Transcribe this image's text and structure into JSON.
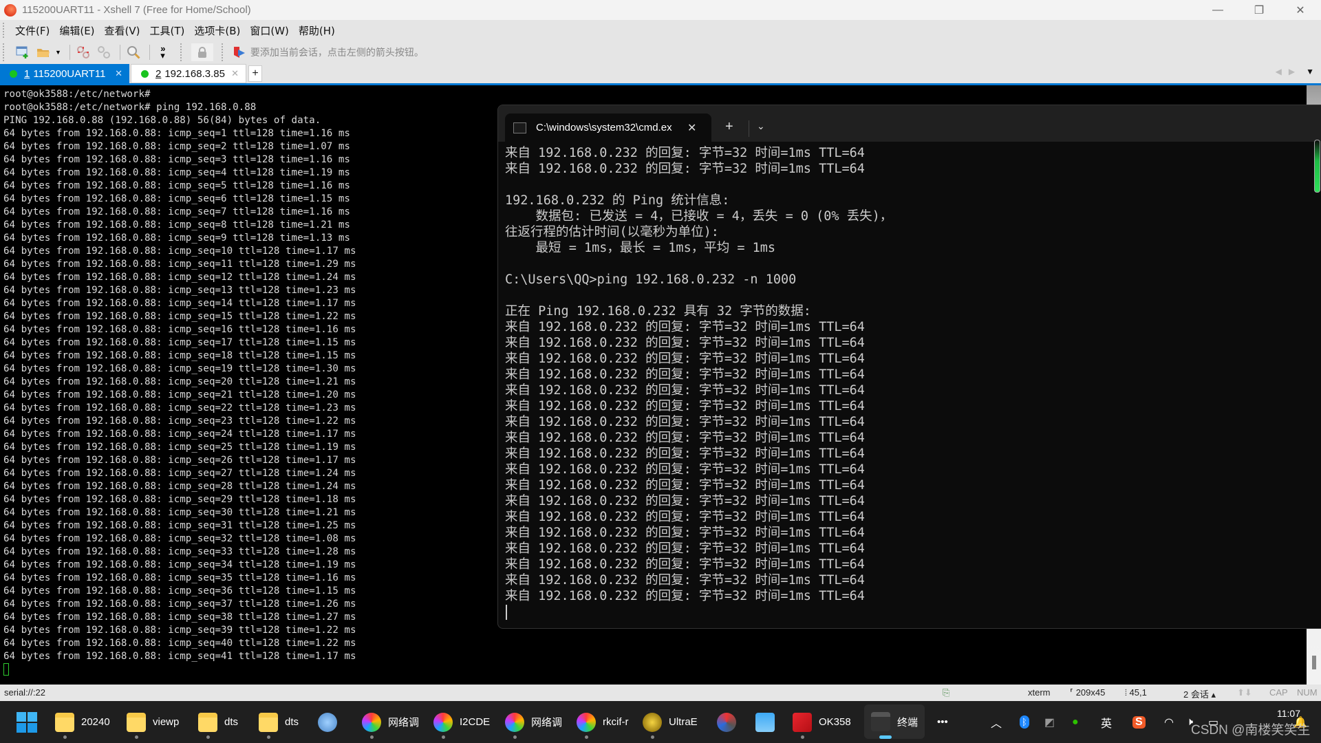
{
  "window": {
    "title": "115200UART11 - Xshell 7 (Free for Home/School)",
    "controls": {
      "minimize": "—",
      "restore": "❐",
      "close": "✕"
    }
  },
  "menu": [
    "文件(F)",
    "编辑(E)",
    "查看(V)",
    "工具(T)",
    "选项卡(B)",
    "窗口(W)",
    "帮助(H)"
  ],
  "toolbar": {
    "hint": "要添加当前会话，点击左侧的箭头按钮。",
    "buttons": [
      "new-session-icon",
      "open-folder-icon",
      "disconnect-icon",
      "reconnect-icon",
      "find-icon",
      "more-icon",
      "lock-icon"
    ]
  },
  "tabs": [
    {
      "index": "1",
      "label": "115200UART11",
      "status": "connected",
      "active": true
    },
    {
      "index": "2",
      "label": "192.168.3.85",
      "status": "connected",
      "active": false
    }
  ],
  "tab_add": "+",
  "xshell": {
    "prompt_lines": [
      "root@ok3588:/etc/network#",
      "root@ok3588:/etc/network# ping 192.168.0.88",
      "PING 192.168.0.88 (192.168.0.88) 56(84) bytes of data."
    ],
    "ping_host": "192.168.0.88",
    "ping_bytes": "64",
    "ttl": "128",
    "replies": [
      {
        "seq": 1,
        "time": "1.16"
      },
      {
        "seq": 2,
        "time": "1.07"
      },
      {
        "seq": 3,
        "time": "1.16"
      },
      {
        "seq": 4,
        "time": "1.19"
      },
      {
        "seq": 5,
        "time": "1.16"
      },
      {
        "seq": 6,
        "time": "1.15"
      },
      {
        "seq": 7,
        "time": "1.16"
      },
      {
        "seq": 8,
        "time": "1.21"
      },
      {
        "seq": 9,
        "time": "1.13"
      },
      {
        "seq": 10,
        "time": "1.17"
      },
      {
        "seq": 11,
        "time": "1.29"
      },
      {
        "seq": 12,
        "time": "1.24"
      },
      {
        "seq": 13,
        "time": "1.23"
      },
      {
        "seq": 14,
        "time": "1.17"
      },
      {
        "seq": 15,
        "time": "1.22"
      },
      {
        "seq": 16,
        "time": "1.16"
      },
      {
        "seq": 17,
        "time": "1.15"
      },
      {
        "seq": 18,
        "time": "1.15"
      },
      {
        "seq": 19,
        "time": "1.30"
      },
      {
        "seq": 20,
        "time": "1.21"
      },
      {
        "seq": 21,
        "time": "1.20"
      },
      {
        "seq": 22,
        "time": "1.23"
      },
      {
        "seq": 23,
        "time": "1.22"
      },
      {
        "seq": 24,
        "time": "1.17"
      },
      {
        "seq": 25,
        "time": "1.19"
      },
      {
        "seq": 26,
        "time": "1.17"
      },
      {
        "seq": 27,
        "time": "1.24"
      },
      {
        "seq": 28,
        "time": "1.24"
      },
      {
        "seq": 29,
        "time": "1.18"
      },
      {
        "seq": 30,
        "time": "1.21"
      },
      {
        "seq": 31,
        "time": "1.25"
      },
      {
        "seq": 32,
        "time": "1.08"
      },
      {
        "seq": 33,
        "time": "1.28"
      },
      {
        "seq": 34,
        "time": "1.19"
      },
      {
        "seq": 35,
        "time": "1.16"
      },
      {
        "seq": 36,
        "time": "1.15"
      },
      {
        "seq": 37,
        "time": "1.26"
      },
      {
        "seq": 38,
        "time": "1.27"
      },
      {
        "seq": 39,
        "time": "1.22"
      },
      {
        "seq": 40,
        "time": "1.22"
      },
      {
        "seq": 41,
        "time": "1.17"
      }
    ]
  },
  "cmd": {
    "tab_title": "C:\\windows\\system32\\cmd.ex",
    "tab_close": "✕",
    "new_tab": "+",
    "dropdown": "⌄",
    "lines": [
      "来自 192.168.0.232 的回复: 字节=32 时间=1ms TTL=64",
      "来自 192.168.0.232 的回复: 字节=32 时间=1ms TTL=64",
      "",
      "192.168.0.232 的 Ping 统计信息:",
      "    数据包: 已发送 = 4，已接收 = 4，丢失 = 0 (0% 丢失)，",
      "往返行程的估计时间(以毫秒为单位):",
      "    最短 = 1ms，最长 = 1ms，平均 = 1ms",
      "",
      "C:\\Users\\QQ>ping 192.168.0.232 -n 1000",
      "",
      "正在 Ping 192.168.0.232 具有 32 字节的数据:"
    ],
    "reply_line": "来自 192.168.0.232 的回复: 字节=32 时间=1ms TTL=64",
    "reply_count": 18
  },
  "statusbar": {
    "connection": "serial://:22",
    "terminal": "xterm",
    "size": "209x45",
    "cursor": "45,1",
    "sessions": "2 会话",
    "cap": "CAP",
    "num": "NUM"
  },
  "taskbar": {
    "items": [
      {
        "label": "20240",
        "icon": "folder-icon"
      },
      {
        "label": "viewp",
        "icon": "folder-icon"
      },
      {
        "label": "dts",
        "icon": "folder-icon"
      },
      {
        "label": "dts",
        "icon": "folder-icon"
      },
      {
        "label": "",
        "icon": "paint-icon"
      },
      {
        "label": "网络调",
        "icon": "net-debug-icon"
      },
      {
        "label": "I2CDE",
        "icon": "net-debug-icon"
      },
      {
        "label": "网络调",
        "icon": "net-debug-icon"
      },
      {
        "label": "rkcif-r",
        "icon": "net-debug-icon"
      },
      {
        "label": "UltraE",
        "icon": "ultraedit-icon"
      },
      {
        "label": "",
        "icon": "sync-icon"
      },
      {
        "label": "",
        "icon": "notepad-icon"
      },
      {
        "label": "OK358",
        "icon": "wps-icon"
      },
      {
        "label": "终端",
        "icon": "terminal-icon"
      }
    ],
    "more": "•••",
    "tray": {
      "ime": "英",
      "clock": "11:07"
    }
  },
  "watermark": "CSDN @南楼笑笑生"
}
